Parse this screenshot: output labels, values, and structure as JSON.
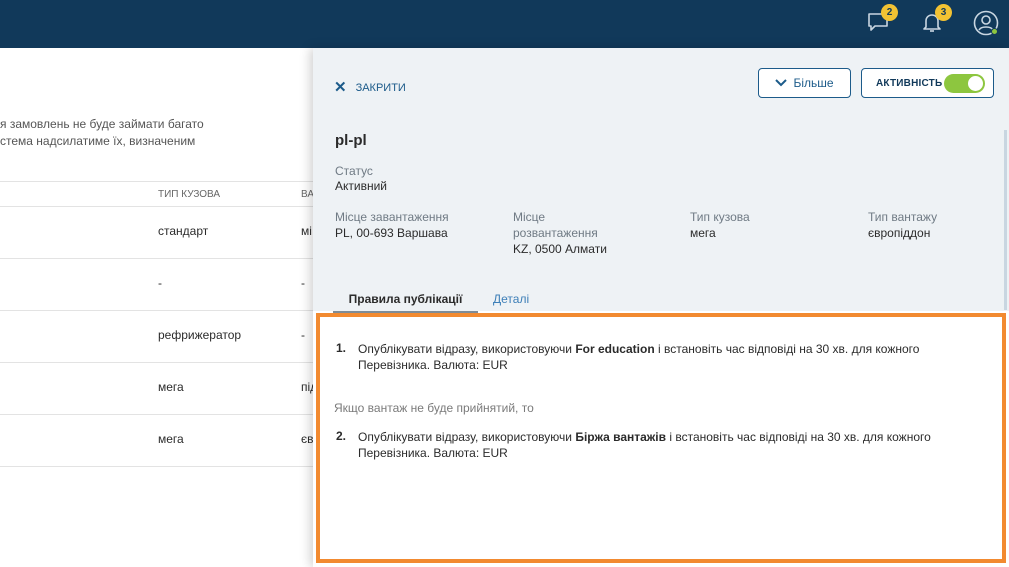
{
  "header": {
    "messages_count": "2",
    "notifications_count": "3"
  },
  "background": {
    "description": "я замовлень не буде займати багато\nстема надсилатиме їх, визначеним",
    "table": {
      "headers": [
        "ТИП КУЗОВА",
        "ВА"
      ],
      "rows": [
        {
          "body_type": "стандарт",
          "cargo": "мі"
        },
        {
          "body_type": "-",
          "cargo": "-"
        },
        {
          "body_type": "рефрижератор",
          "cargo": "-"
        },
        {
          "body_type": "мега",
          "cargo": "під"
        },
        {
          "body_type": "мега",
          "cargo": "єв"
        }
      ]
    }
  },
  "drawer": {
    "close_label": "ЗАКРИТИ",
    "more_label": "Більше",
    "activity_label": "АКТИВНІСТЬ",
    "activity_on": true,
    "title": "pl-pl",
    "status_label": "Статус",
    "status_value": "Активний",
    "loading_label": "Місце завантаження",
    "loading_value": "PL, 00-693 Варшава",
    "unloading_label_1": "Місце",
    "unloading_label_2": "розвантаження",
    "unloading_value": "KZ, 0500 Алмати",
    "body_type_label": "Тип кузова",
    "body_type_value": "мега",
    "cargo_type_label": "Тип вантажу",
    "cargo_type_value": "європіддон",
    "tabs": [
      "Правила публікації",
      "Деталі"
    ],
    "rules": {
      "rule1_num": "1.",
      "rule1_prefix": "Опублікувати відразу, використовуючи ",
      "rule1_name": "For education",
      "rule1_suffix": " і встановіть час відповіді на 30 хв. для кожного",
      "rule1_line2": "Перевізника. Валюта: EUR",
      "between": "Якщо вантаж не буде прийнятий, то",
      "rule2_num": "2.",
      "rule2_prefix": "Опублікувати відразу, використовуючи ",
      "rule2_name": "Біржа вантажів",
      "rule2_suffix": " і встановіть час відповіді на 30 хв. для кожного",
      "rule2_line2": "Перевізника. Валюта: EUR"
    }
  },
  "colors": {
    "topbar": "#11395a",
    "accent": "#1c5b8a",
    "badge": "#f2c233",
    "toggle": "#8dc63f",
    "highlight_border": "#f28a30"
  },
  "icons": [
    "chat-icon",
    "bell-icon",
    "user-icon",
    "close-icon",
    "chevron-down-icon"
  ]
}
